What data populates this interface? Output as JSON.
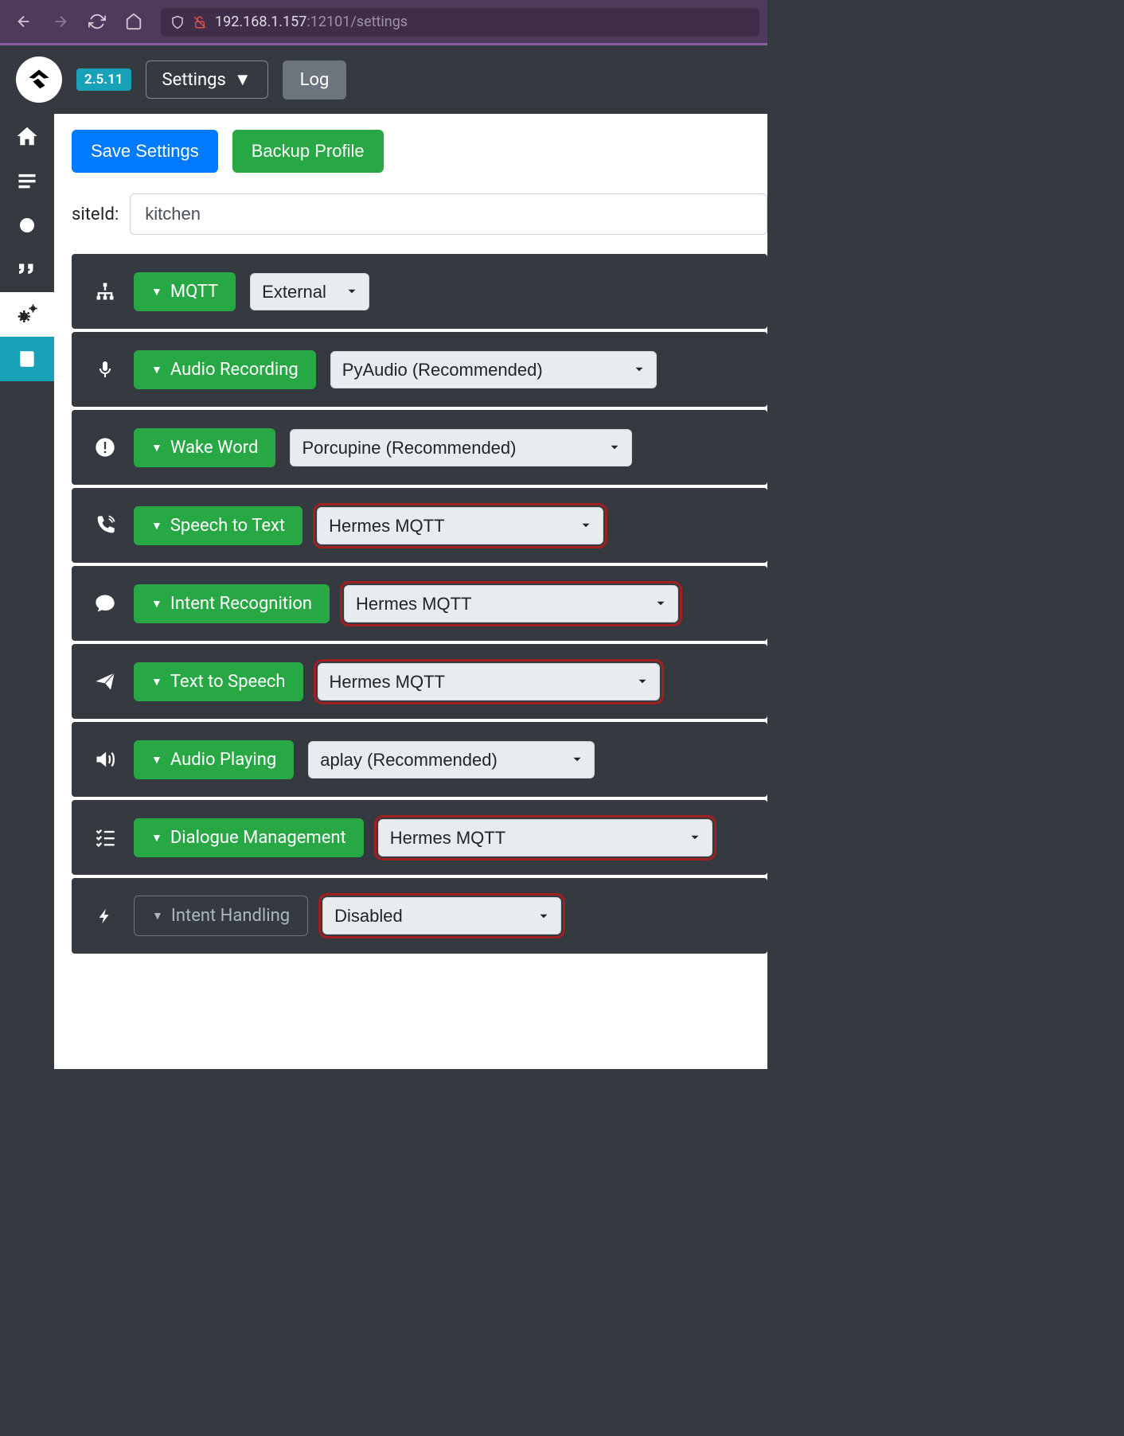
{
  "browser": {
    "url_prefix": "192.168.1.157",
    "url_port_path": ":12101/settings"
  },
  "header": {
    "version": "2.5.11",
    "settings_label": "Settings",
    "log_label": "Log"
  },
  "actions": {
    "save": "Save Settings",
    "backup": "Backup Profile"
  },
  "site": {
    "label": "siteId:",
    "value": "kitchen"
  },
  "rows": [
    {
      "key": "mqtt",
      "label": "MQTT",
      "icon": "network",
      "value": "External",
      "highlight": false,
      "muted": false
    },
    {
      "key": "audio_recording",
      "label": "Audio Recording",
      "icon": "mic",
      "value": "PyAudio (Recommended)",
      "highlight": false,
      "muted": false
    },
    {
      "key": "wake_word",
      "label": "Wake Word",
      "icon": "alert",
      "value": "Porcupine (Recommended)",
      "highlight": false,
      "muted": false
    },
    {
      "key": "speech_to_text",
      "label": "Speech to Text",
      "icon": "phone",
      "value": "Hermes MQTT",
      "highlight": true,
      "muted": false
    },
    {
      "key": "intent_recognition",
      "label": "Intent Recognition",
      "icon": "comment",
      "value": "Hermes MQTT",
      "highlight": true,
      "muted": false
    },
    {
      "key": "text_to_speech",
      "label": "Text to Speech",
      "icon": "paperplane",
      "value": "Hermes MQTT",
      "highlight": true,
      "muted": false
    },
    {
      "key": "audio_playing",
      "label": "Audio Playing",
      "icon": "volume",
      "value": "aplay (Recommended)",
      "highlight": false,
      "muted": false
    },
    {
      "key": "dialogue_management",
      "label": "Dialogue Management",
      "icon": "tasks",
      "value": "Hermes MQTT",
      "highlight": true,
      "muted": false
    },
    {
      "key": "intent_handling",
      "label": "Intent Handling",
      "icon": "bolt",
      "value": "Disabled",
      "highlight": true,
      "muted": true
    }
  ]
}
